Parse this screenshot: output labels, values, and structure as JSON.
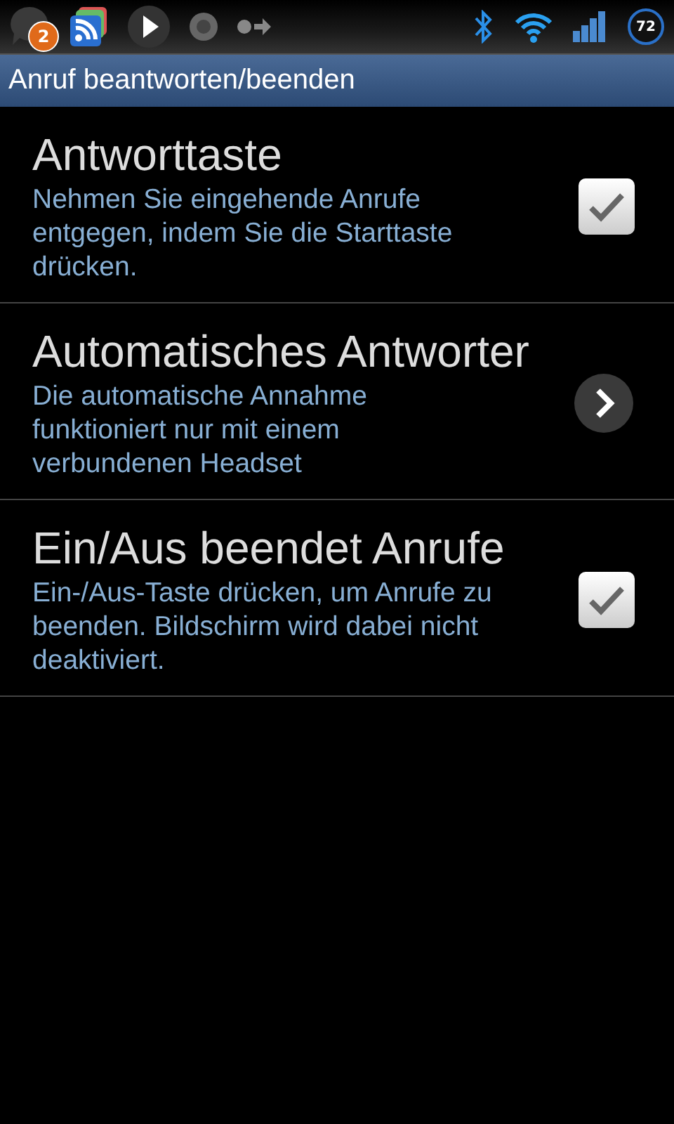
{
  "status_bar": {
    "notification_badge": "2",
    "battery_percent": "72"
  },
  "title_bar": {
    "title": "Anruf beantworten/beenden"
  },
  "settings": [
    {
      "kind": "checkbox",
      "title": "Antworttaste",
      "summary": "Nehmen Sie eingehende Anrufe entgegen, indem Sie die Starttaste drücken.",
      "checked": true
    },
    {
      "kind": "link",
      "title": "Automatisches Antworter",
      "summary": "Die automatische Annahme funktioniert nur mit einem verbundenen Headset"
    },
    {
      "kind": "checkbox",
      "title": "Ein/Aus beendet Anrufe",
      "summary": "Ein-/Aus-Taste drücken, um Anrufe zu beenden. Bildschirm wird dabei nicht deaktiviert.",
      "checked": true
    }
  ]
}
